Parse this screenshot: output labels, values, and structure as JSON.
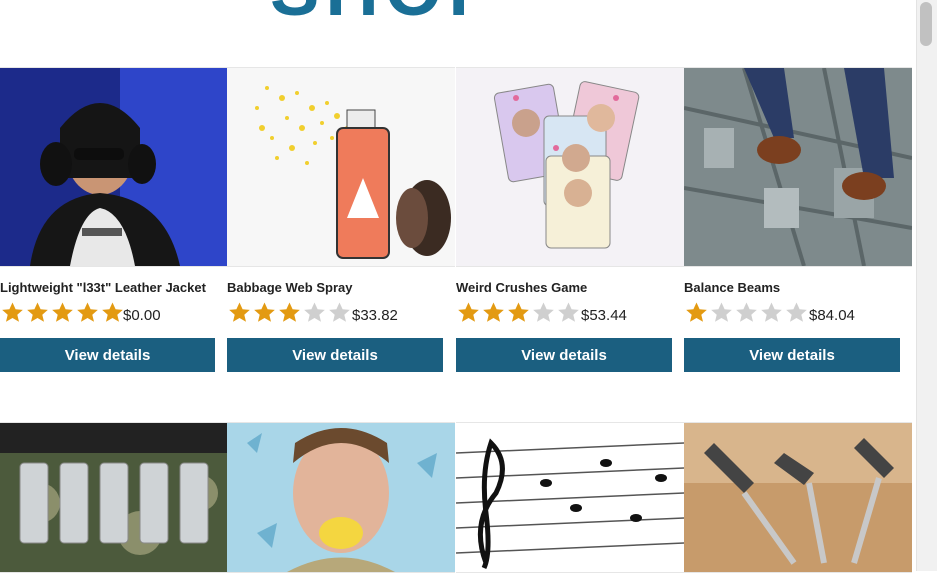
{
  "header": {
    "logo_text": "SHOP"
  },
  "products": [
    {
      "name": "Lightweight \"l33t\" Leather Jacket",
      "rating": 5,
      "price": "$0.00",
      "button": "View details",
      "image": "person-headphones-image"
    },
    {
      "name": "Babbage Web Spray",
      "rating": 3,
      "price": "$33.82",
      "button": "View details",
      "image": "spray-can-image"
    },
    {
      "name": "Weird Crushes Game",
      "rating": 3,
      "price": "$53.44",
      "button": "View details",
      "image": "cards-game-image"
    },
    {
      "name": "Balance Beams",
      "rating": 1,
      "price": "$84.04",
      "button": "View details",
      "image": "feet-skyscraper-image"
    }
  ],
  "second_row": [
    {
      "image": "can-belt-image"
    },
    {
      "image": "lemon-face-image"
    },
    {
      "image": "music-notes-image"
    },
    {
      "image": "darts-image"
    }
  ],
  "colors": {
    "button_bg": "#1b5f80",
    "star_filled": "#e39a12",
    "star_empty": "#cfcfcf"
  },
  "icons": {
    "star": "star-icon"
  }
}
